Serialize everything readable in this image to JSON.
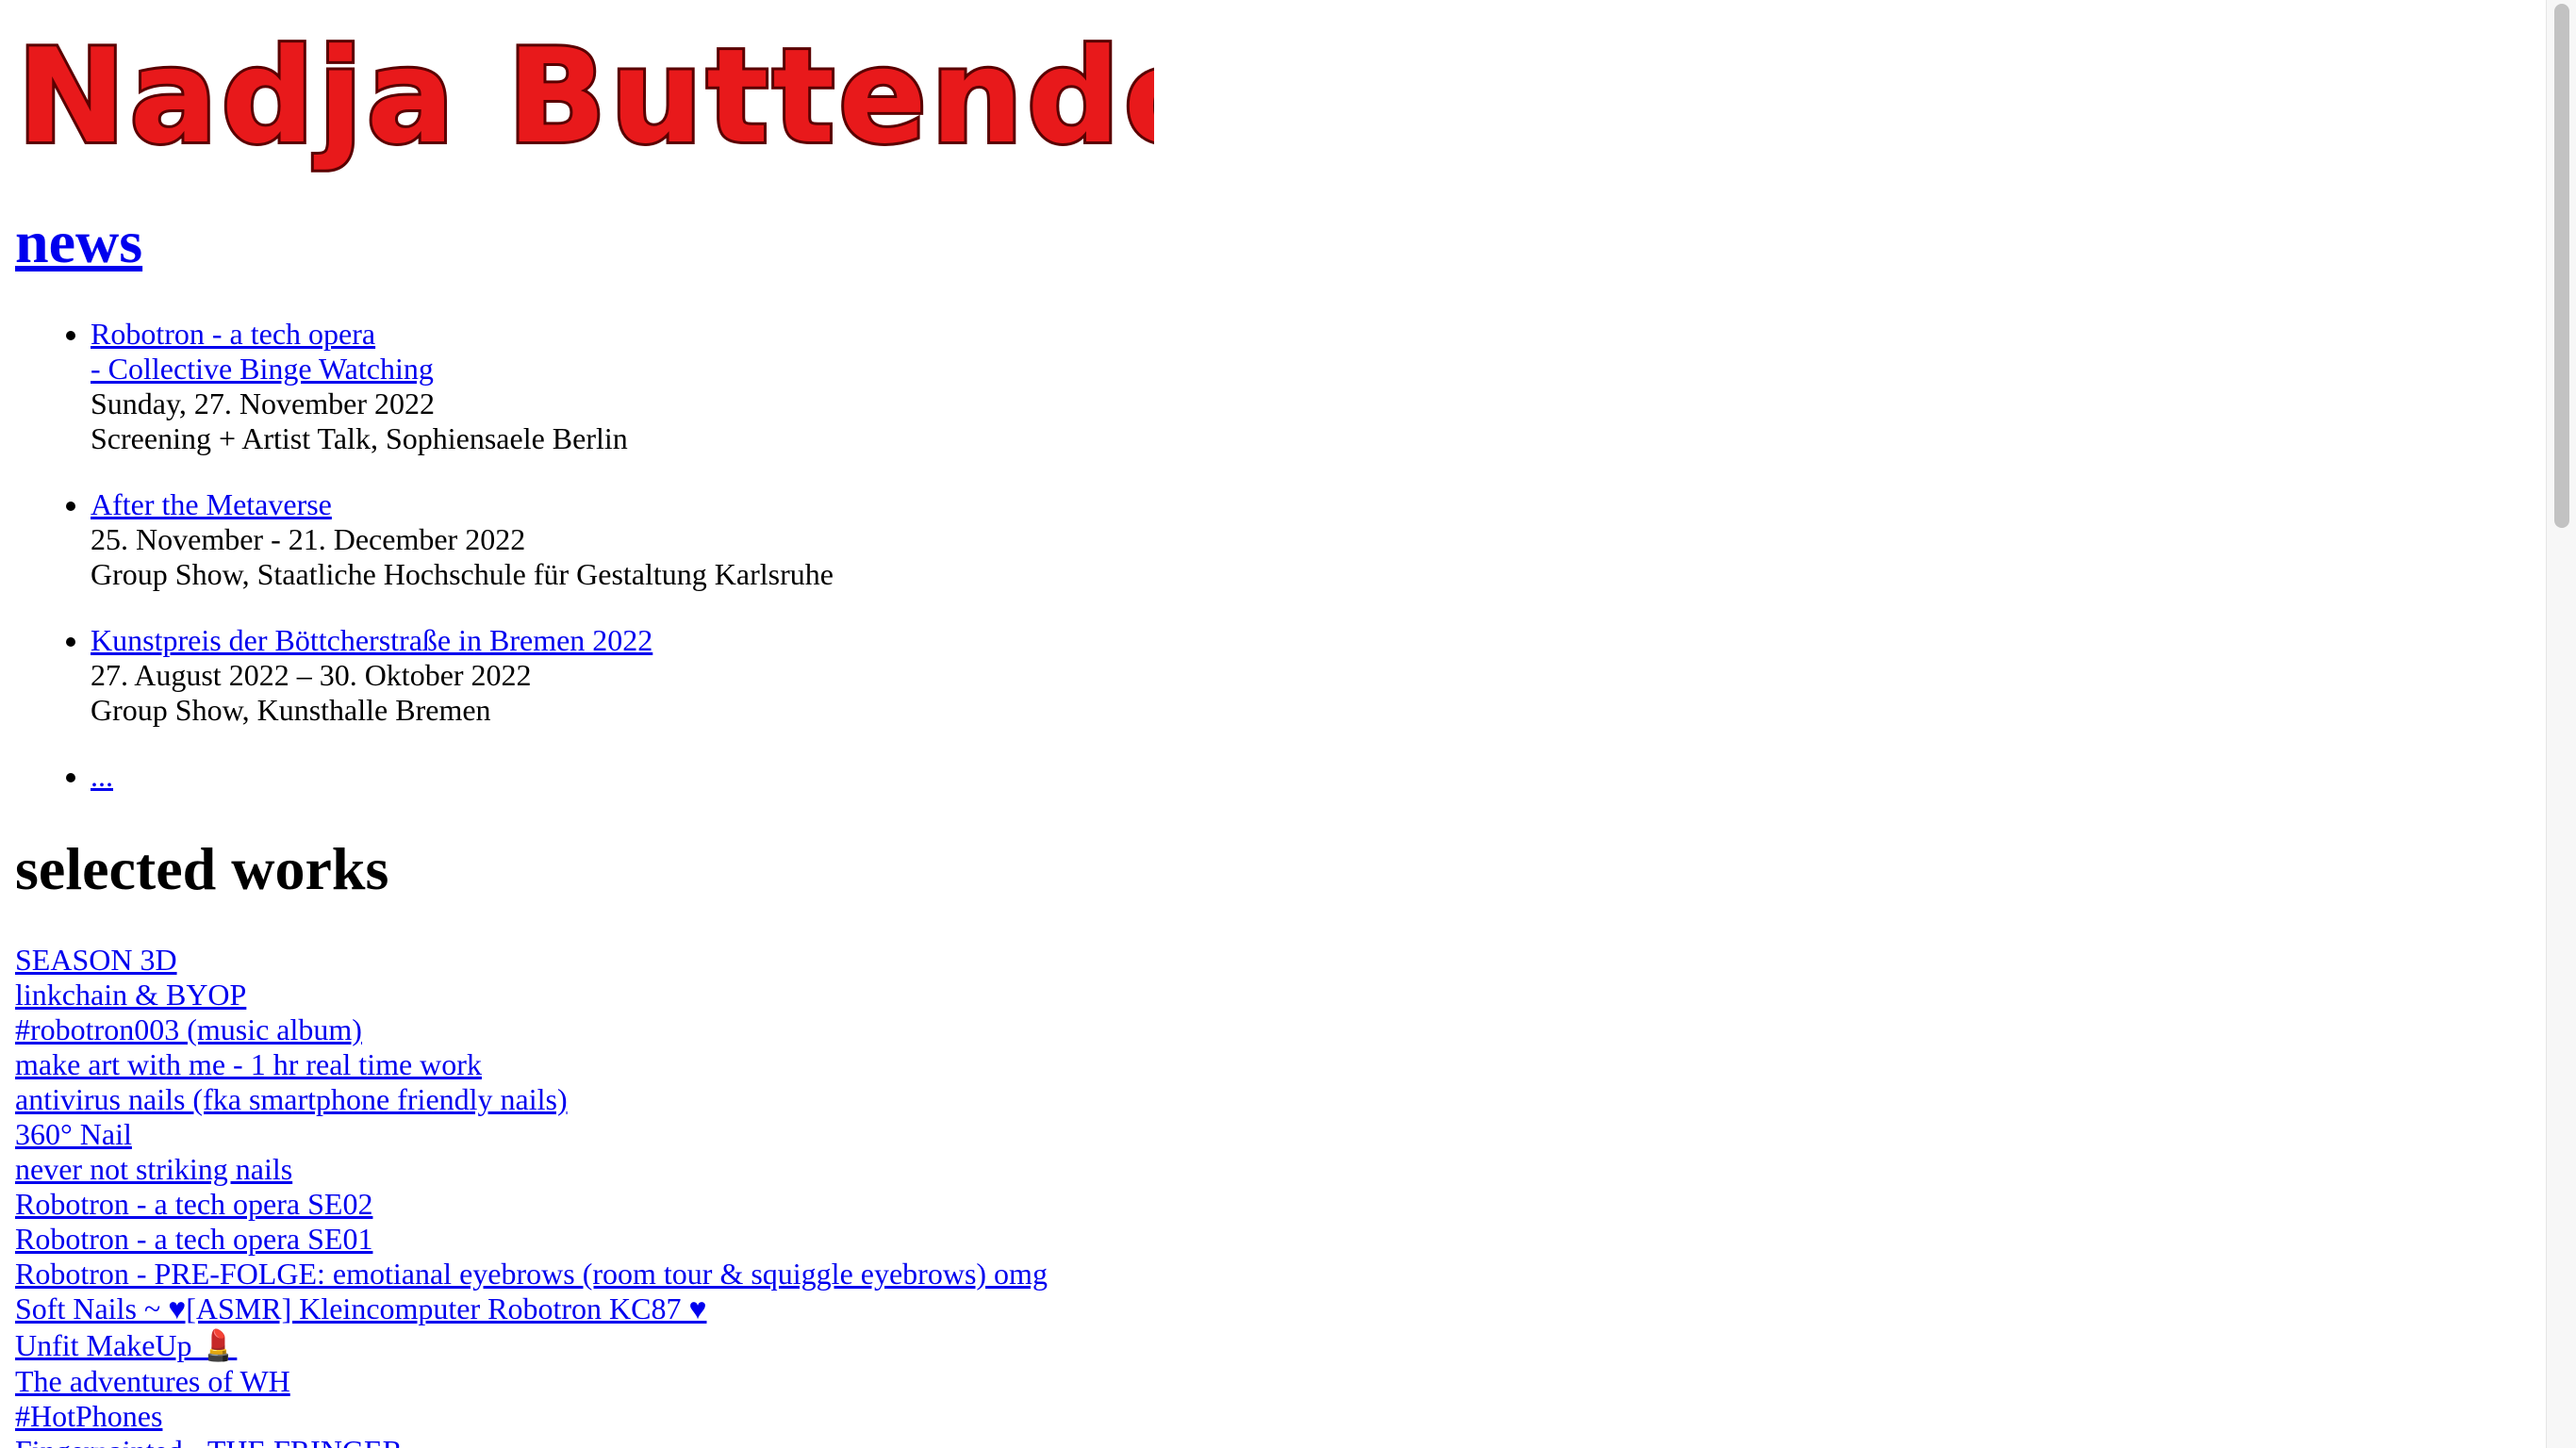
{
  "logo": {
    "text": "Nadja Buttendorf"
  },
  "news": {
    "heading": "news",
    "items": [
      {
        "title_line1": "Robotron - a tech opera",
        "title_line2": "- Collective Binge Watching",
        "date": "Sunday, 27. November 2022",
        "details": "Screening + Artist Talk, Sophiensaele Berlin"
      },
      {
        "title": "After the Metaverse",
        "date": "25. November - 21. December 2022",
        "details": "Group Show, Staatliche Hochschule für Gestaltung Karlsruhe"
      },
      {
        "title": "Kunstpreis der Böttcherstraße in Bremen 2022",
        "date": "27. August 2022 – 30. Oktober 2022",
        "details": "Group Show, Kunsthalle Bremen"
      }
    ],
    "more_link": "..."
  },
  "works": {
    "heading": "selected works",
    "items": [
      "SEASON 3D",
      "linkchain & BYOP",
      "#robotron003 (music album)",
      "make art with me - 1 hr real time work",
      "antivirus nails (fka smartphone friendly nails)",
      "360° Nail",
      "never not striking nails",
      "Robotron - a tech opera SE02",
      "Robotron - a tech opera SE01",
      "Robotron - PRE-FOLGE: emotianal eyebrows (room tour & squiggle eyebrows) omg",
      "Soft Nails ~ ♥[ASMR] Kleincomputer Robotron KC87 ♥",
      "Unfit MakeUp 💄",
      "The adventures of WH",
      "#HotPhones",
      "Fingerpainted - THE FRINGER"
    ]
  },
  "colors": {
    "link": "#0000ee",
    "logo_fill": "#e8191b",
    "logo_outline": "#5a0000"
  }
}
